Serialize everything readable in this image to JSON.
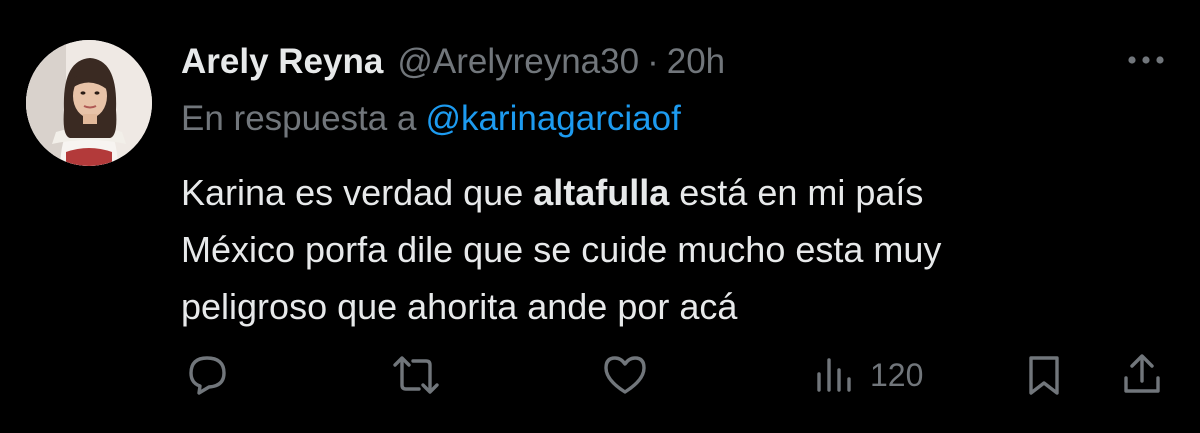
{
  "user": {
    "display_name": "Arely Reyna",
    "handle": "@Arelyreyna30",
    "separator": "·",
    "time": "20h"
  },
  "reply": {
    "prefix": "En respuesta a",
    "mention": "@karinagarciaof"
  },
  "tweet": {
    "line1_pre": "Karina es verdad que ",
    "line1_bold": "altafulla",
    "line1_post": " está en mi país",
    "line2": "México porfa dile que se cuide mucho esta muy",
    "line3": "peligroso que ahorita ande por acá"
  },
  "actions": {
    "views": "120"
  },
  "icons": {
    "more": "more-icon",
    "reply": "reply-icon",
    "retweet": "retweet-icon",
    "like": "heart-icon",
    "views": "analytics-icon",
    "bookmark": "bookmark-icon",
    "share": "share-icon"
  },
  "colors": {
    "background": "#000000",
    "primary_text": "#e7e9ea",
    "secondary_text": "#71767b",
    "link": "#1d9bf0"
  }
}
